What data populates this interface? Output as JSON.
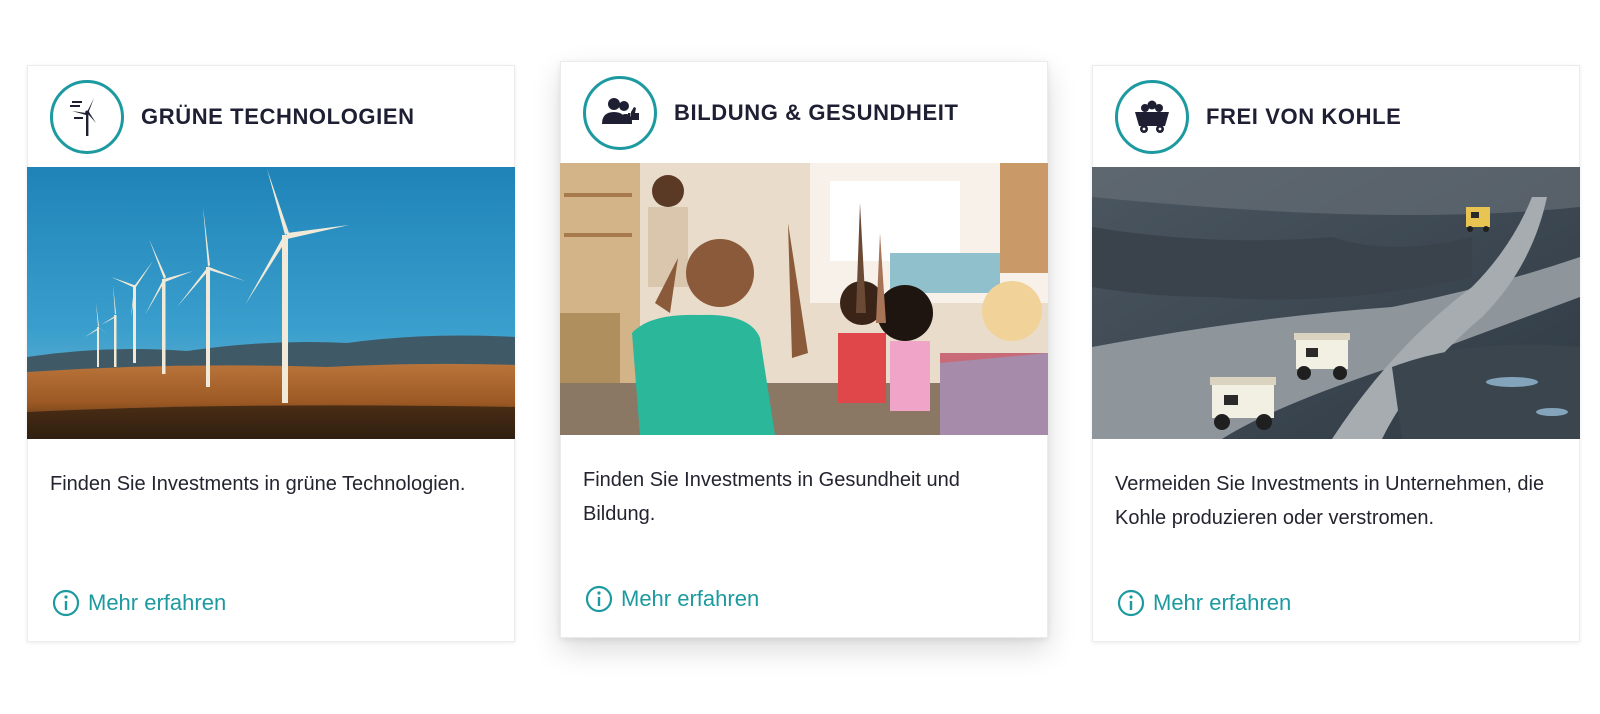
{
  "colors": {
    "accent": "#1d9aa0",
    "title": "#1e1f33",
    "text": "#23242f"
  },
  "cards": [
    {
      "title": "GRÜNE TECHNOLOGIEN",
      "icon": "wind-turbine-icon",
      "image": "wind-turbines-photo",
      "description": "Finden Sie Investments in grüne Technologien.",
      "link": "Mehr erfahren"
    },
    {
      "title": "BILDUNG & GESUNDHEIT",
      "icon": "people-thumbs-up-icon",
      "image": "classroom-children-photo",
      "description": "Finden Sie Investments in Gesundheit und Bildung.",
      "link": "Mehr erfahren"
    },
    {
      "title": "FREI VON KOHLE",
      "icon": "coal-cart-icon",
      "image": "coal-mine-trucks-photo",
      "description": "Vermeiden Sie Investments in Unternehmen, die Kohle produzieren oder verstromen.",
      "link": "Mehr erfahren"
    }
  ]
}
